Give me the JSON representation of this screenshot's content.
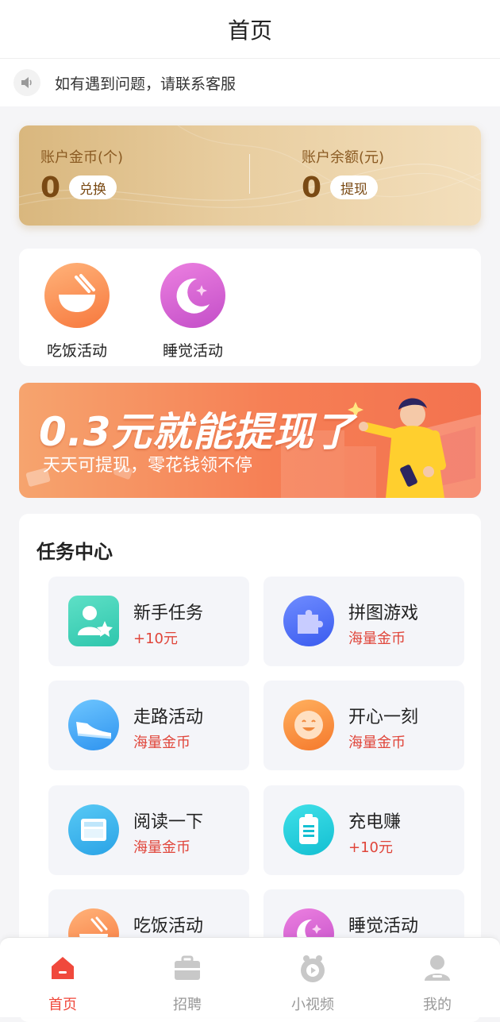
{
  "header": {
    "title": "首页"
  },
  "notice": {
    "icon": "speaker-icon",
    "text": "如有遇到问题，请联系客服"
  },
  "account": {
    "coins": {
      "label": "账户金币(个)",
      "value": "0",
      "button": "兑换"
    },
    "balance": {
      "label": "账户余额(元)",
      "value": "0",
      "button": "提现"
    }
  },
  "activities": [
    {
      "name": "吃饭活动",
      "icon": "rice-bowl-icon"
    },
    {
      "name": "睡觉活动",
      "icon": "moon-icon"
    }
  ],
  "banner": {
    "headline": "0.3元就能提现了",
    "subline": "天天可提现，零花钱领不停"
  },
  "tasks": {
    "heading": "任务中心",
    "items": [
      {
        "name": "新手任务",
        "reward": "+10元",
        "icon": "new-user-icon"
      },
      {
        "name": "拼图游戏",
        "reward": "海量金币",
        "icon": "puzzle-icon"
      },
      {
        "name": "走路活动",
        "reward": "海量金币",
        "icon": "sneaker-icon"
      },
      {
        "name": "开心一刻",
        "reward": "海量金币",
        "icon": "smile-icon"
      },
      {
        "name": "阅读一下",
        "reward": "海量金币",
        "icon": "newspaper-icon"
      },
      {
        "name": "充电赚",
        "reward": "+10元",
        "icon": "battery-icon"
      },
      {
        "name": "吃饭活动",
        "reward": "",
        "icon": "rice-bowl-icon"
      },
      {
        "name": "睡觉活动",
        "reward": "",
        "icon": "moon-icon"
      }
    ]
  },
  "tabbar": {
    "items": [
      {
        "label": "首页",
        "icon": "home-icon",
        "active": true
      },
      {
        "label": "招聘",
        "icon": "briefcase-icon",
        "active": false
      },
      {
        "label": "小视频",
        "icon": "video-icon",
        "active": false
      },
      {
        "label": "我的",
        "icon": "user-icon",
        "active": false
      }
    ]
  },
  "colors": {
    "accent": "#f0493c",
    "gold": "#7a4a14",
    "reward": "#e0453a"
  }
}
